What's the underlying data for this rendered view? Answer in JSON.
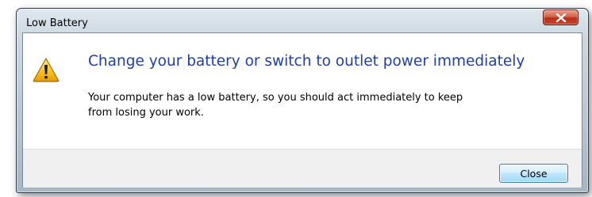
{
  "window": {
    "title": "Low Battery",
    "close_icon": "close-x-icon"
  },
  "dialog": {
    "icon": "warning-icon",
    "main_instruction": "Change your battery or switch to outlet power immediately",
    "content_line_1": "Your computer has a low battery, so you should act immediately to keep",
    "content_line_2": "from losing your work."
  },
  "footer": {
    "close_label": "Close"
  },
  "colors": {
    "main_instruction": "#1f3ea8",
    "close_button_red": "#c7452a",
    "footer_bg": "#f0f0f0"
  }
}
